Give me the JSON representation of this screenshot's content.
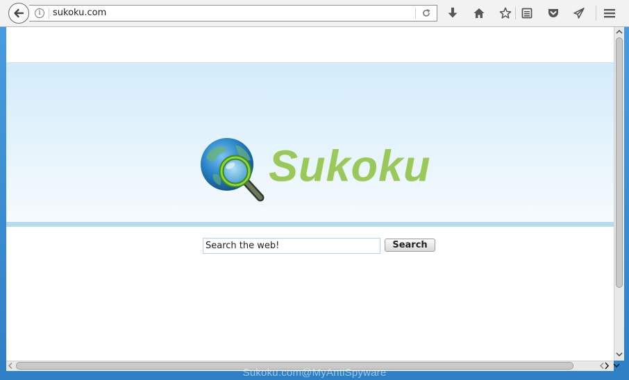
{
  "browser": {
    "url": "sukoku.com",
    "info_icon_glyph": "i",
    "toolbar_icons": [
      "download-icon",
      "home-icon",
      "bookmark-star-icon",
      "reading-list-icon",
      "pocket-icon",
      "send-tab-icon",
      "menu-icon"
    ]
  },
  "page": {
    "logo_text": "Sukoku",
    "search_input_value": "Search the web!",
    "search_button_label": "Search",
    "brand_color": "#9ac85e",
    "banner_color": "#d3ecfa"
  },
  "watermark": "Sukoku.com@MyAntiSpyware"
}
